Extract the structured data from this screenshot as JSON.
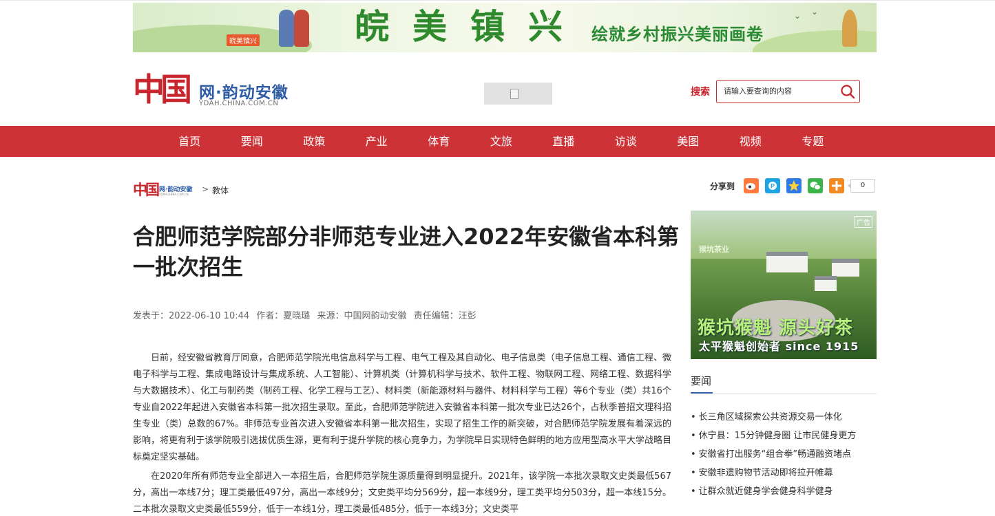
{
  "banner": {
    "badge": "皖美镇兴",
    "headline": "皖美镇兴",
    "slogan": "绘就乡村振兴美丽画卷"
  },
  "header": {
    "logo_mark": "中国",
    "site_name": "网·韵动安徽",
    "site_url": "YDAH.CHINA.COM.CN",
    "search_label": "搜索",
    "search_placeholder": "请输入要查询的内容"
  },
  "nav": {
    "items": [
      {
        "label": "首页"
      },
      {
        "label": "要闻"
      },
      {
        "label": "政策"
      },
      {
        "label": "产业"
      },
      {
        "label": "体育"
      },
      {
        "label": "文旅"
      },
      {
        "label": "直播"
      },
      {
        "label": "访谈"
      },
      {
        "label": "美图"
      },
      {
        "label": "视频"
      },
      {
        "label": "专题"
      }
    ]
  },
  "breadcrumb": {
    "logo_mark": "中国",
    "site_name": "网·韵动安徽",
    "site_url": "YDAH.CHINA.COM.CN",
    "separator": ">",
    "current": "教体"
  },
  "share": {
    "label": "分享到",
    "icons": [
      {
        "name": "weibo-icon",
        "color": "#ff7a3c"
      },
      {
        "name": "tencent-qq-icon",
        "color": "#1ea4e4"
      },
      {
        "name": "qzone-icon",
        "color": "#2e7be6"
      },
      {
        "name": "wechat-icon",
        "color": "#3bb44a"
      },
      {
        "name": "more-plus-icon",
        "color": "#f28a23"
      }
    ],
    "count": "0"
  },
  "article": {
    "title": "合肥师范学院部分非师范专业进入2022年安徽省本科第一批次招生",
    "meta": {
      "published": "发表于：2022-06-10 10:44",
      "author": "作者：夏晓璐",
      "source": "来源：中国网韵动安徽",
      "editor": "责任编辑：汪彭"
    },
    "paragraphs": [
      "日前，经安徽省教育厅同意，合肥师范学院光电信息科学与工程、电气工程及其自动化、电子信息类（电子信息工程、通信工程、微电子科学与工程、集成电路设计与集成系统、人工智能）、计算机类（计算机科学与技术、软件工程、物联网工程、网络工程、数据科学与大数据技术）、化工与制药类（制药工程、化学工程与工艺）、材料类（新能源材料与器件、材料科学与工程）等6个专业（类）共16个专业自2022年起进入安徽省本科第一批次招生录取。至此，合肥师范学院进入安徽省本科第一批次专业已达26个，占秋季普招文理科招生专业（类）总数的67%。非师范专业首次进入安徽省本科第一批次招生，实现了招生工作的新突破，对合肥师范学院发展有着深远的影响，将更有利于该学院吸引选拔优质生源，更有利于提升学院的核心竞争力，为学院早日实现特色鲜明的地方应用型高水平大学战略目标奠定坚实基础。",
      "在2020年所有师范专业全部进入一本招生后，合肥师范学院生源质量得到明显提升。2021年，该学院一本批次录取文史类最低567分，高出一本线7分；理工类最低497分，高出一本线9分；文史类平均分569分，超一本线9分，理工类平均分503分，超一本线15分。二本批次录取文史类最低559分，低于一本线1分，理工类最低485分，低于一本线3分；文史类平"
    ]
  },
  "sidebar": {
    "ad": {
      "brand": "猴坑茶业",
      "corner": "广告",
      "line1": "猴坑猴魁 源头好茶",
      "line2": "太平猴魁创始者 since 1915"
    },
    "news_heading": "要闻",
    "news": [
      "长三角区域探索公共资源交易一体化",
      "休宁县：15分钟健身圈 让市民健身更方",
      "安徽省打出服务“组合拳”畅通融资堵点",
      "安徽非遗购物节活动即将拉开帷幕",
      "让群众就近健身学会健身科学健身"
    ]
  },
  "colors": {
    "brand_red": "#cd3237",
    "logo_blue": "#2e5da6"
  }
}
